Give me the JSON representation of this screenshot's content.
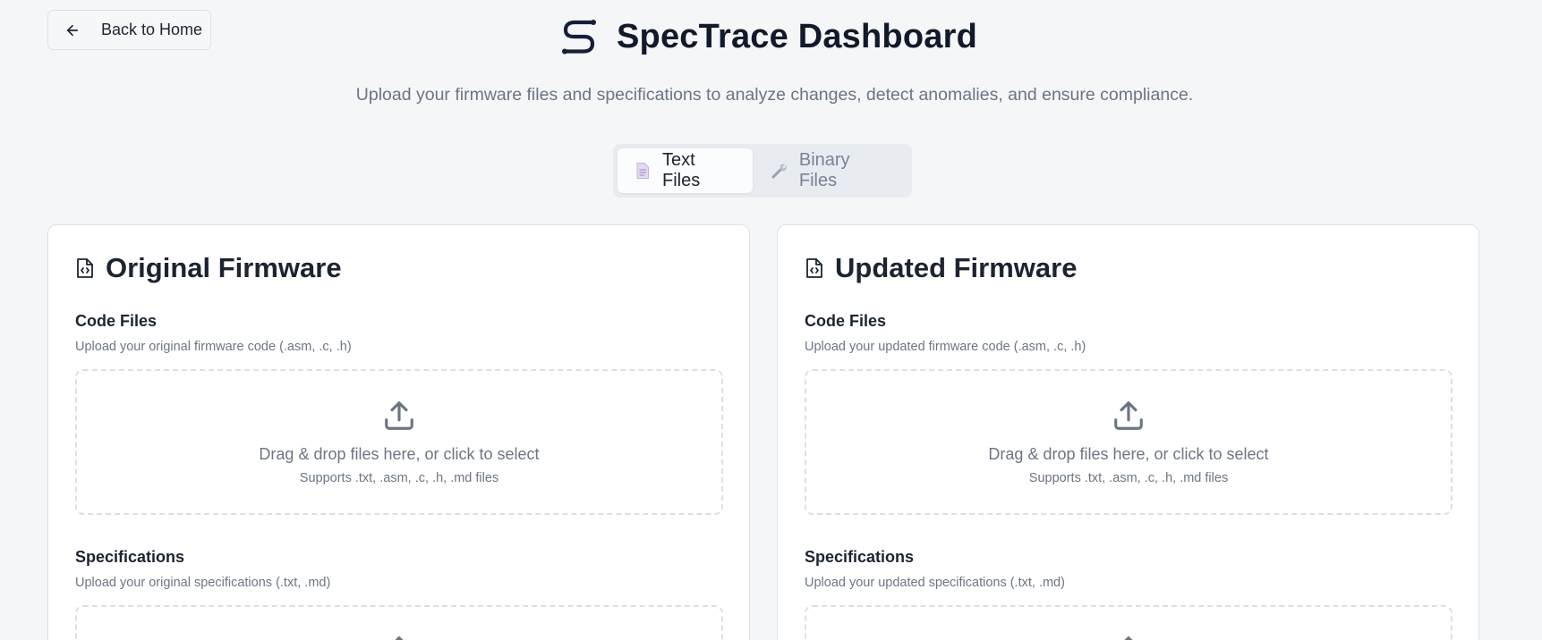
{
  "nav": {
    "back_label": "Back to Home"
  },
  "header": {
    "title": "SpecTrace Dashboard",
    "subtitle": "Upload your firmware files and specifications to analyze changes, detect anomalies, and ensure compliance."
  },
  "tabs": [
    {
      "label": "Text Files",
      "icon": "document-icon",
      "active": true
    },
    {
      "label": "Binary Files",
      "icon": "wrench-icon",
      "active": false
    }
  ],
  "cards": {
    "original": {
      "title": "Original Firmware",
      "code": {
        "label": "Code Files",
        "description": "Upload your original firmware code (.asm, .c, .h)",
        "drop_text": "Drag & drop files here, or click to select",
        "supports": "Supports .txt, .asm, .c, .h, .md files"
      },
      "specs": {
        "label": "Specifications",
        "description": "Upload your original specifications (.txt, .md)"
      }
    },
    "updated": {
      "title": "Updated Firmware",
      "code": {
        "label": "Code Files",
        "description": "Upload your updated firmware code (.asm, .c, .h)",
        "drop_text": "Drag & drop files here, or click to select",
        "supports": "Supports .txt, .asm, .c, .h, .md files"
      },
      "specs": {
        "label": "Specifications",
        "description": "Upload your updated specifications (.txt, .md)"
      }
    }
  },
  "colors": {
    "background": "#f4f6f8",
    "card": "#ffffff",
    "title": "#111a2a",
    "muted": "#6b7584",
    "tab_track": "#e8ebf0",
    "doc_icon_accent": "#b9a6d6"
  }
}
